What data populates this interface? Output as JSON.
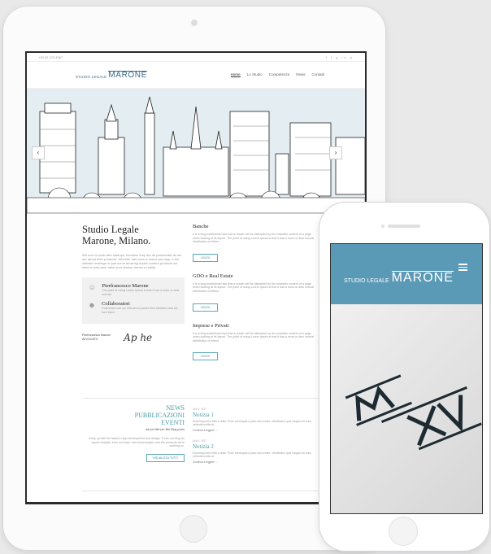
{
  "topbar": {
    "phone": "+39 02 123 4567",
    "social": "f t g in p"
  },
  "nav": {
    "logo_small": "STUDIO LEGALE",
    "logo_big": "MARONE",
    "menu": [
      "Home",
      "Lo Studio",
      "Competenze",
      "News",
      "Contatti"
    ]
  },
  "hero": {
    "prev_icon": "‹",
    "next_icon": "›"
  },
  "intro": {
    "title_line1": "Studio Legale",
    "title_line2": "Marone, Milano.",
    "paragraph": "We love to work with startups, because they are as passionate as we are about their products. Whether has been a brand new app, a full website redesign or just some amazing social content products we want to help and make your startup dream a reality."
  },
  "people": [
    {
      "icon": "person-icon",
      "name": "Pierfrancesco Marone",
      "text": "The point of using Lorem Ipsum is that it has a more-or-less normal."
    },
    {
      "icon": "group-icon",
      "name": "Collaboratori",
      "text": "Customers use our themes to power their websites and we love them."
    }
  ],
  "signature": {
    "caption_line1": "Pierfrancesco Marone",
    "caption_line2": "AVVOCATO",
    "signature_text": "Ap he"
  },
  "services": [
    {
      "title": "Banche",
      "text": "It is a long established fact that a reader will be distracted by the readable content of a page when looking at its layout. The point of using Lorem Ipsum is that it has a more-or-less normal distribution of letters.",
      "button": "LEGGI"
    },
    {
      "title": "GDO e Real Estate",
      "text": "It is a long established fact that a reader will be distracted by the readable content of a page when looking at its layout. The point of using Lorem Ipsum is that it has a more-or-less normal distribution of letters.",
      "button": "LEGGI"
    },
    {
      "title": "Imprese e Privati",
      "text": "It is a long established fact that a reader will be distracted by the readable content of a page when looking at its layout. The point of using Lorem Ipsum is that it has a more-or-less normal distribution of letters.",
      "button": "LEGGI"
    }
  ],
  "news": {
    "title_line1": "NEWS",
    "title_line2": "PUBBLICAZIONI",
    "title_line3": "EVENTI",
    "subtitle": "dai più filtri per filtri Blog posts",
    "paragraph": "Keep up with the latest in app development and design. Turbo our blog for expert insights, from our team, new technologies and the products we're working on.",
    "button": "VISUALIZZA TUTTI"
  },
  "notizie": [
    {
      "date": "Sep 9, 2017",
      "title": "Notizia 1",
      "text": "Endoring lorem felis a dolor. Proin consequat a justo sed ornare. Vestibulum quis magna vel nunc vehicula mollis at.",
      "more": "Continua a leggere →"
    },
    {
      "date": "Sep 9, 2017",
      "title": "Notizia 2",
      "text": "Endoring lorem felis a dolor. Proin consequat a justo sed ornare. Vestibulum quis magna vel nunc vehicula mollis at.",
      "more": "Continua a leggere →"
    }
  ],
  "phone": {
    "logo_small": "STUDIO LEGALE",
    "logo_big": "MARONE",
    "emblem": "M XV"
  },
  "colors": {
    "accent": "#4a98a6",
    "phone_header": "#5b9ab6",
    "logo_blue": "#3a6a8a"
  }
}
